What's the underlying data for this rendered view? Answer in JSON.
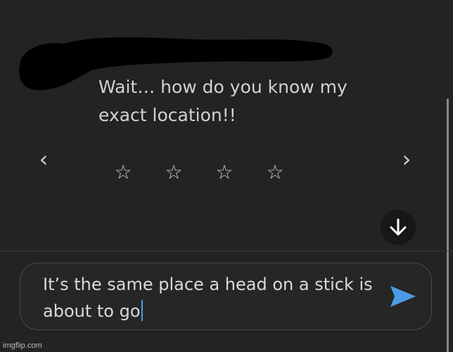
{
  "chat": {
    "message": "Wait… how do you know my\nexact location!!",
    "nav": {
      "prev_icon": "‹",
      "next_icon": "›"
    },
    "rating": {
      "stars": [
        "☆",
        "☆",
        "☆",
        "☆"
      ],
      "value": 0,
      "max": 4
    },
    "scroll_down_icon": "arrow-down-icon"
  },
  "composer": {
    "value": "It’s the same place a head on a stick is\nabout to go",
    "send_icon": "send-icon",
    "accent": "#4d9be6"
  },
  "colors": {
    "background": "#232323",
    "text": "#d2d2d2",
    "redaction": "#000000"
  },
  "watermark": "imgflip.com"
}
